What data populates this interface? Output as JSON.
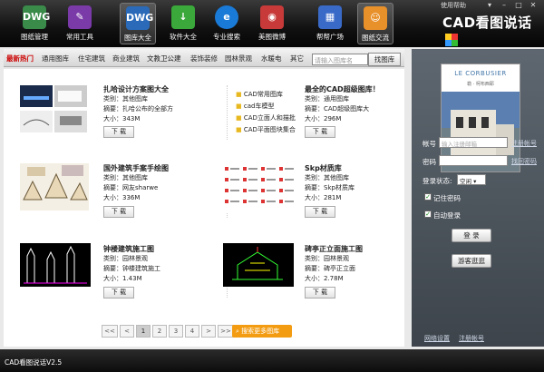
{
  "toolbar": {
    "items": [
      {
        "label": "图纸管理",
        "icon": "dwg-file-icon",
        "color": "#3a8a4a"
      },
      {
        "label": "常用工具",
        "icon": "tools-icon",
        "color": "#7a3aa8"
      },
      {
        "label": "图库大全",
        "icon": "library-icon",
        "color": "#2a6ab8"
      },
      {
        "label": "软件大全",
        "icon": "software-icon",
        "color": "#3aa83a"
      },
      {
        "label": "专业搜索",
        "icon": "ie-search-icon",
        "color": "#1a7ad8"
      },
      {
        "label": "美图微博",
        "icon": "weibo-icon",
        "color": "#c83a3a"
      },
      {
        "label": "帮帮广场",
        "icon": "building-icon",
        "color": "#3a6ac8"
      },
      {
        "label": "图纸交流",
        "icon": "people-icon",
        "color": "#e8902a"
      }
    ],
    "active_index": 2
  },
  "app": {
    "name": "CAD看图说话",
    "help": "使用帮助",
    "status": "CAD看图说话V2.5"
  },
  "tabs": [
    "最新热门",
    "通用图库",
    "住宅建筑",
    "商业建筑",
    "文教卫公建",
    "装饰装修",
    "园林景观",
    "水暖电",
    "其它"
  ],
  "search": {
    "placeholder": "请输入图库名",
    "button": "找图库"
  },
  "items": [
    {
      "title": "扎哈设计方案图大全",
      "category": "类别：其他图库",
      "summary": "摘要：扎哈公布的全部方",
      "size": "大小：343M",
      "download": "下 载"
    },
    {
      "title": "",
      "category": "",
      "summary": "",
      "size": "",
      "download": "",
      "files": [
        "CAD常用图库",
        "cad车模型",
        "CAD立面人和描批",
        "CAD平面图块集合"
      ]
    },
    {
      "title": "最全的CAD超级图库！",
      "category": "类别：通用图库",
      "summary": "摘要：CAD超级图库大",
      "size": "大小：296M",
      "download": "下 载"
    },
    {
      "title": "国外建筑手案手绘图",
      "category": "类别：其他图库",
      "summary": "摘要：网友sharwe",
      "size": "大小：336M",
      "download": "下 载"
    },
    {
      "title": "Skp材质库",
      "category": "类别：其他图库",
      "summary": "摘要：Skp材质库",
      "size": "大小：281M",
      "download": "下 载"
    },
    {
      "title": "钟楼建筑施工图",
      "category": "类别：园林景观",
      "summary": "摘要：钟楼建筑施工",
      "size": "大小：1.43M",
      "download": "下 载"
    },
    {
      "title": "碑亭正立面施工图",
      "category": "类别：园林景观",
      "summary": "摘要：碑亭正立面",
      "size": "大小：2.78M",
      "download": "下 载"
    }
  ],
  "pager": {
    "buttons": [
      "<<",
      "<",
      "1",
      "2",
      "3",
      "4",
      ">",
      ">>"
    ],
    "current": "1",
    "more": "搜索更多图库"
  },
  "login": {
    "ad_title": "LE CORBUSIER",
    "ad_sub": "勒 · 柯布西耶",
    "account_label": "帐号",
    "account_placeholder": "输入注册邮箱",
    "register_link": "注册帐号",
    "password_label": "密码",
    "forgot_link": "找回密码",
    "state_label": "登录状态:",
    "state_value": "空闲",
    "remember": "记住密码",
    "auto_login": "自动登录",
    "login_button": "登 录",
    "guest_button": "游客逛逛",
    "network_link": "网络设置",
    "register_link2": "注册帐号"
  }
}
